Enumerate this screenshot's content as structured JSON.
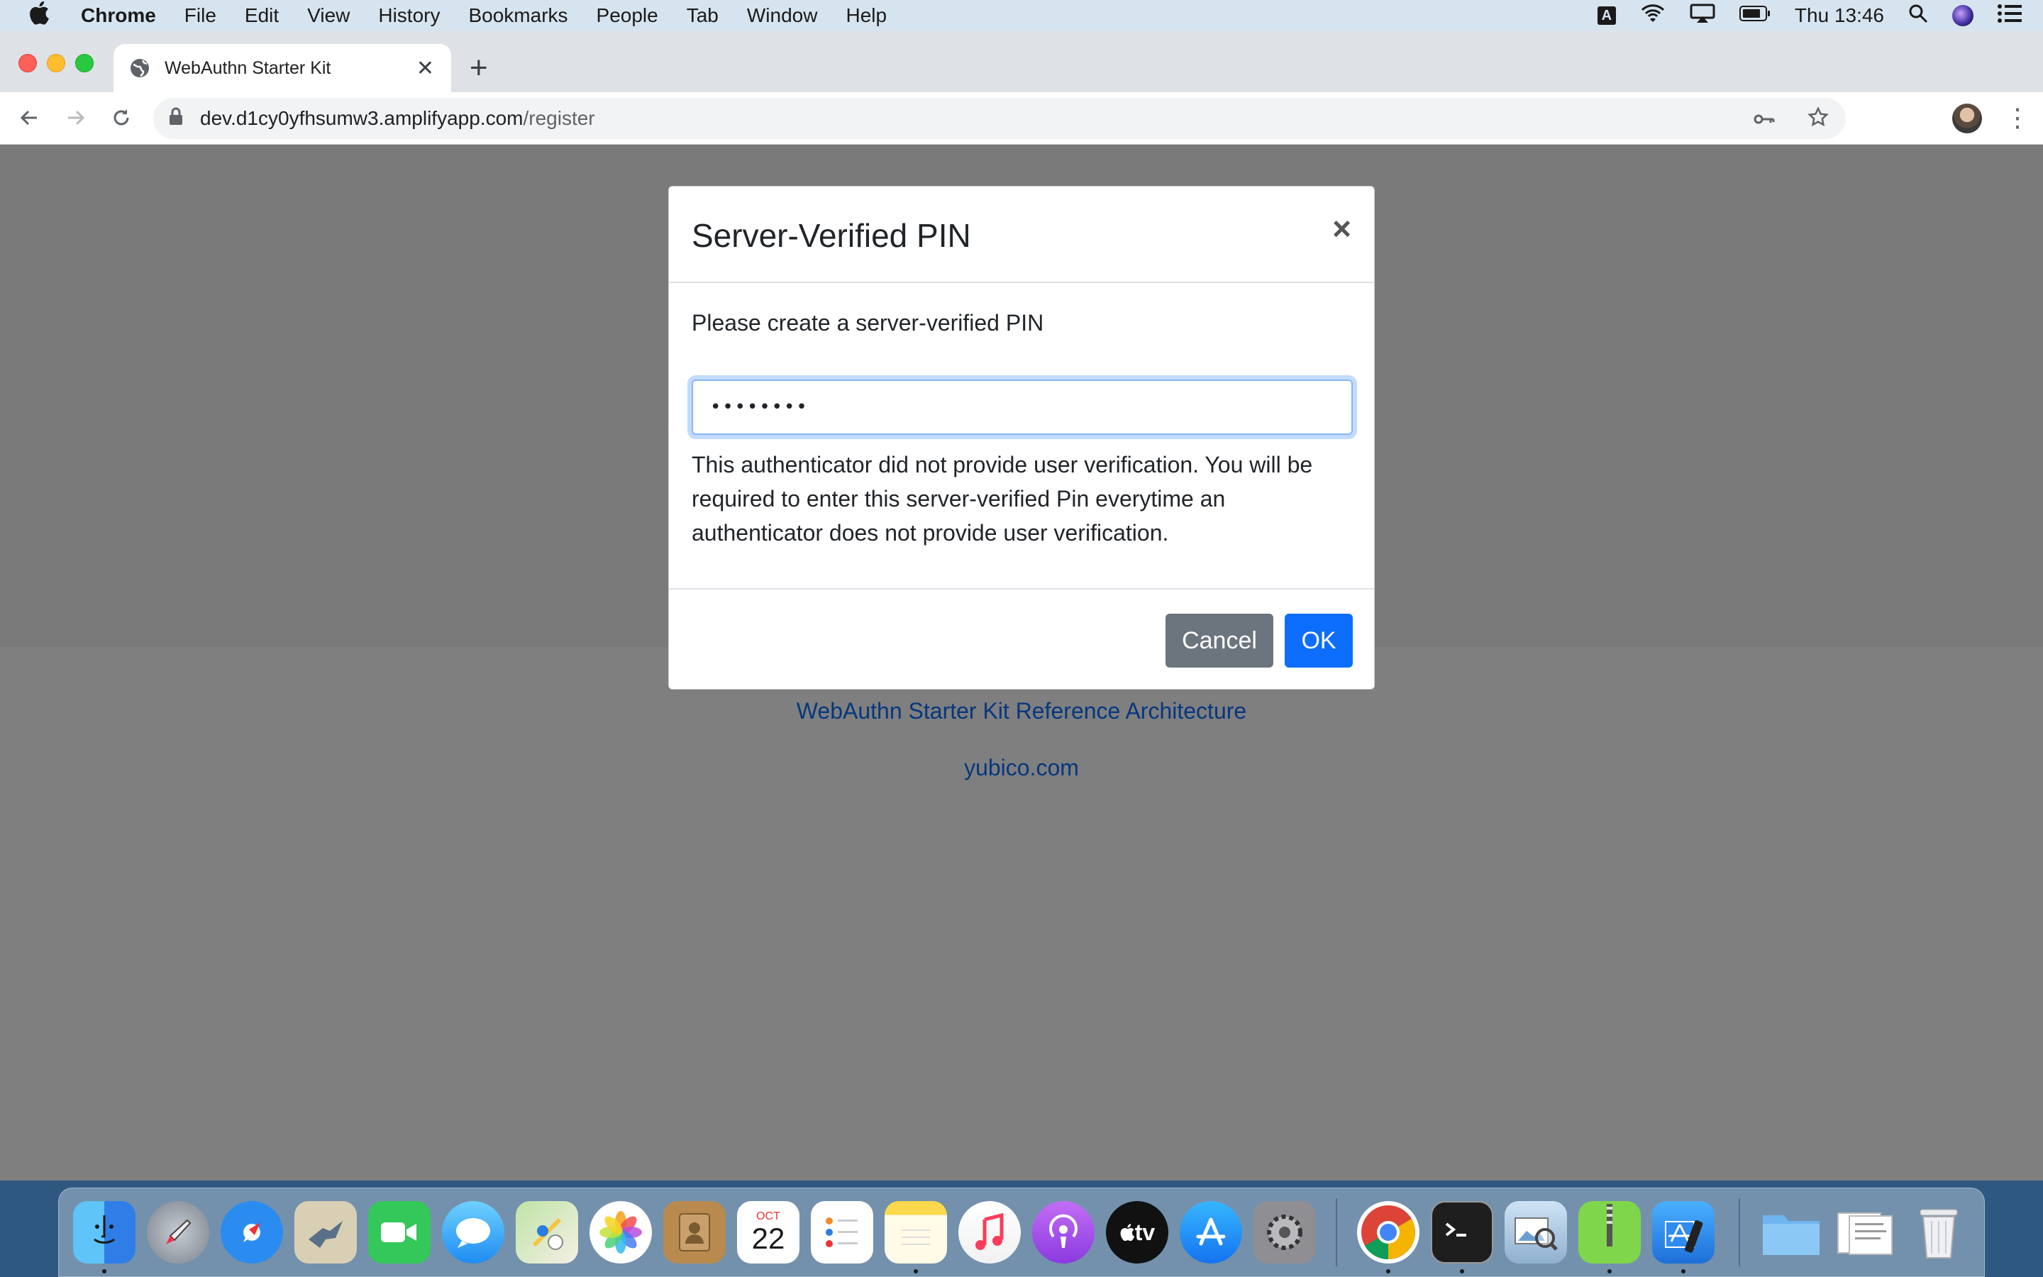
{
  "menubar": {
    "app_name": "Chrome",
    "menus": [
      "File",
      "Edit",
      "View",
      "History",
      "Bookmarks",
      "People",
      "Tab",
      "Window",
      "Help"
    ],
    "input_badge": "A",
    "clock": "Thu 13:46"
  },
  "browser": {
    "tab_title": "WebAuthn Starter Kit",
    "url_host": "dev.d1cy0yfhsumw3.amplifyapp.com",
    "url_path": "/register"
  },
  "page": {
    "links": [
      "WebAuthn Starter Kit Reference Architecture",
      "yubico.com"
    ]
  },
  "modal": {
    "title": "Server-Verified PIN",
    "close_symbol": "×",
    "prompt": "Please create a server-verified PIN",
    "pin_value": "••••••••",
    "note": "This authenticator did not provide user verification. You will be required to enter this server-verified Pin everytime an authenticator does not provide user verification.",
    "cancel_label": "Cancel",
    "ok_label": "OK"
  },
  "dock": {
    "calendar_month": "OCT",
    "calendar_day": "22",
    "tv_label": "tv",
    "icons": [
      "finder-icon",
      "launchpad-icon",
      "safari-icon",
      "mail-icon",
      "facetime-icon",
      "messages-icon",
      "maps-icon",
      "photos-icon",
      "contacts-icon",
      "calendar-icon",
      "reminders-icon",
      "notes-icon",
      "music-icon",
      "podcasts-icon",
      "apple-tv-icon",
      "app-store-icon",
      "system-preferences-icon",
      "chrome-icon",
      "terminal-icon",
      "preview-icon",
      "archive-icon",
      "xcode-icon",
      "folder-icon",
      "documents-icon",
      "trash-icon"
    ]
  }
}
